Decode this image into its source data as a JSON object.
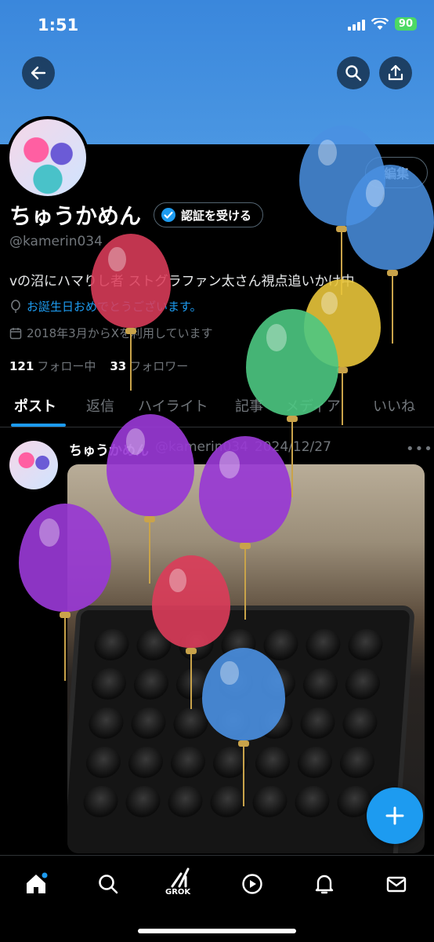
{
  "status_bar": {
    "time": "1:51",
    "battery": "90"
  },
  "profile": {
    "edit_label": "編集",
    "display_name": "ちゅうかめん",
    "verify_label": "認証を受ける",
    "handle": "@kamerin034",
    "bio": "vの沼にハマりし者 ストグラファン太さん視点追いかけ中",
    "birthday": "お誕生日おめでとうございます。",
    "joined": "2018年3月からXを利用しています",
    "following_count": "121",
    "following_label": "フォロー中",
    "followers_count": "33",
    "followers_label": "フォロワー"
  },
  "tabs": [
    {
      "label": "ポスト"
    },
    {
      "label": "返信"
    },
    {
      "label": "ハイライト"
    },
    {
      "label": "記事"
    },
    {
      "label": "メディア"
    },
    {
      "label": "いいね"
    }
  ],
  "post": {
    "author": "ちゅうかめん",
    "handle": "@kamerin034",
    "date": "2024/12/27"
  },
  "nav": {
    "grok_label": "GROK"
  },
  "icons": [
    "back-icon",
    "search-icon",
    "share-icon",
    "verified-badge-icon",
    "balloon-icon",
    "calendar-icon",
    "more-icon",
    "plus-icon",
    "home-icon",
    "grok-icon",
    "video-icon",
    "bell-icon",
    "mail-icon"
  ],
  "colors": {
    "accent": "#1d9bf0",
    "banner": "#3a87dc",
    "background": "#000000"
  }
}
